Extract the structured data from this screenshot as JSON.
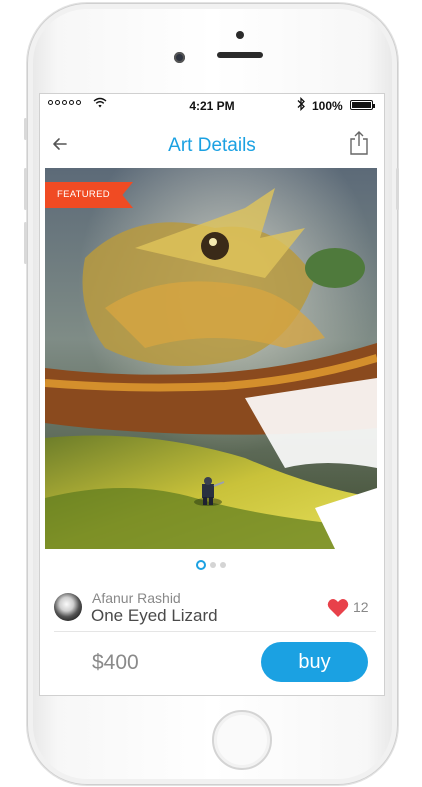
{
  "status_bar": {
    "time": "4:21 PM",
    "battery": "100%",
    "signal_icon": "signal-dots-icon",
    "wifi_icon": "wifi-icon",
    "bluetooth_icon": "bluetooth-icon"
  },
  "nav": {
    "title": "Art Details",
    "back_icon": "back-arrow-icon",
    "share_icon": "share-icon"
  },
  "art": {
    "badge": "FEATURED",
    "page_count": 3,
    "current_page": 1
  },
  "artist": {
    "name": "Afanur Rashid",
    "artwork_title": "One Eyed Lizard",
    "likes": "12",
    "like_icon": "heart-icon"
  },
  "purchase": {
    "price": "$400",
    "buy_label": "buy"
  },
  "colors": {
    "accent": "#1ba1e2",
    "badge": "#f04b23",
    "heart": "#e8414a"
  }
}
